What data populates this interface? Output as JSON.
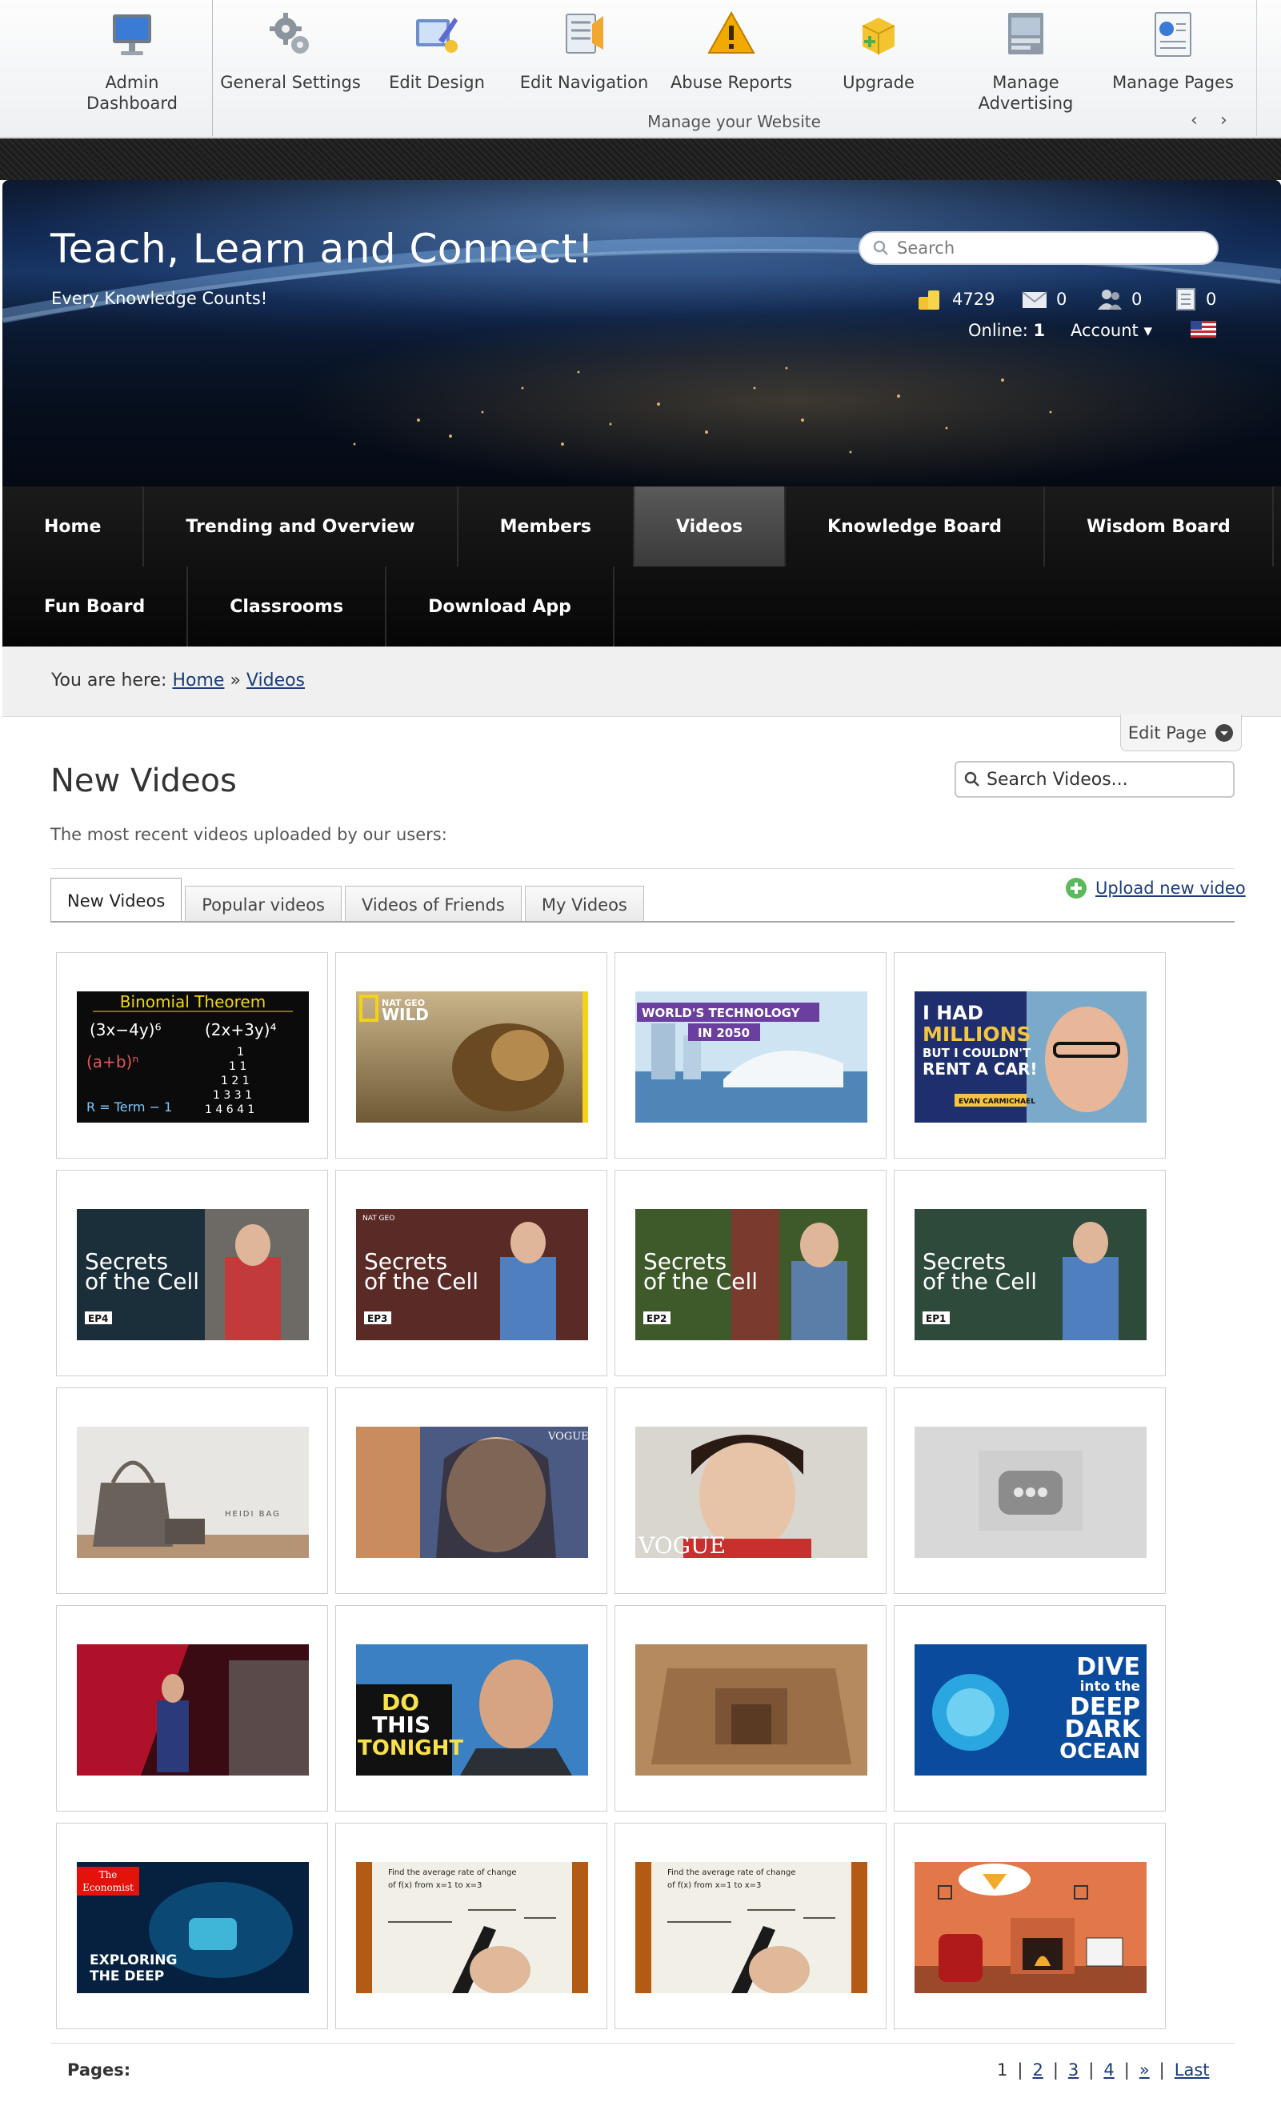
{
  "admin_toolbar": {
    "items": [
      {
        "label": "Admin Dashboard",
        "icon": "monitor-icon"
      },
      {
        "label": "General Settings",
        "icon": "gears-icon"
      },
      {
        "label": "Edit Design",
        "icon": "paint-icon"
      },
      {
        "label": "Edit Navigation",
        "icon": "navigation-icon"
      },
      {
        "label": "Abuse Reports",
        "icon": "warning-icon"
      },
      {
        "label": "Upgrade",
        "icon": "upgrade-box-icon"
      },
      {
        "label": "Manage Advertising",
        "icon": "advertising-icon"
      },
      {
        "label": "Manage Pages",
        "icon": "pages-icon"
      }
    ],
    "caption": "Manage your Website"
  },
  "header": {
    "title": "Teach, Learn and Connect!",
    "tagline": "Every Knowledge Counts!",
    "search_placeholder": "Search",
    "stats": {
      "points": "4729",
      "messages": "0",
      "friend_requests": "0",
      "notifications": "0"
    },
    "online_label": "Online:",
    "online_count": "1",
    "account_label": "Account ▾"
  },
  "nav": {
    "row1": [
      "Home",
      "Trending and Overview",
      "Members",
      "Videos",
      "Knowledge Board",
      "Wisdom Board"
    ],
    "row2": [
      "Fun Board",
      "Classrooms",
      "Download App"
    ],
    "active": "Videos"
  },
  "breadcrumb": {
    "prefix": "You are here:",
    "home": "Home",
    "sep": "»",
    "current": "Videos"
  },
  "edit_page_label": "Edit Page",
  "content": {
    "title": "New Videos",
    "search_placeholder": "Search Videos...",
    "description": "The most recent videos uploaded by our users:",
    "tabs": [
      "New Videos",
      "Popular videos",
      "Videos of Friends",
      "My Videos"
    ],
    "active_tab": "New Videos",
    "upload_label": "Upload new video"
  },
  "videos": [
    {
      "thumb_text": [
        "Binomial Theorem",
        "(3x−4y)⁶",
        "(2x+3y)⁴",
        "(a+b)ⁿ",
        "R = Term − 1"
      ]
    },
    {
      "thumb_text": [
        "NAT GEO",
        "WILD"
      ]
    },
    {
      "thumb_text": [
        "WORLD'S TECHNOLOGY",
        "IN 2050"
      ]
    },
    {
      "thumb_text": [
        "I HAD",
        "MILLIONS",
        "BUT I COULDN'T",
        "RENT A CAR!",
        "EVAN CARMICHAEL"
      ]
    },
    {
      "thumb_text": [
        "Secrets",
        "of the Cell",
        "EP4"
      ]
    },
    {
      "thumb_text": [
        "NAT GEO",
        "Secrets",
        "of the Cell",
        "EP3"
      ]
    },
    {
      "thumb_text": [
        "Secrets",
        "of the Cell",
        "EP2"
      ]
    },
    {
      "thumb_text": [
        "Secrets",
        "of the Cell",
        "EP1"
      ]
    },
    {
      "thumb_text": [
        "HEIDI BAG"
      ]
    },
    {
      "thumb_text": [
        "VOGUE"
      ]
    },
    {
      "thumb_text": [
        "VOGUE"
      ]
    },
    {
      "thumb_text": []
    },
    {
      "thumb_text": []
    },
    {
      "thumb_text": [
        "DO",
        "THIS",
        "TONIGHT"
      ]
    },
    {
      "thumb_text": []
    },
    {
      "thumb_text": [
        "DIVE",
        "into the",
        "DEEP",
        "DARK",
        "OCEAN"
      ]
    },
    {
      "thumb_text": [
        "The",
        "Economist",
        "EXPLORING",
        "THE DEEP"
      ]
    },
    {
      "thumb_text": [
        "Find the average rate of change",
        "of f(x) from x=1 to x=3"
      ]
    },
    {
      "thumb_text": [
        "Find the average rate of change",
        "of f(x) from x=1 to x=3"
      ]
    },
    {
      "thumb_text": []
    }
  ],
  "pagination": {
    "label": "Pages:",
    "current": "1",
    "pages": [
      "2",
      "3",
      "4"
    ],
    "next": "»",
    "last": "Last"
  },
  "colors": {
    "link": "#1b3d7a",
    "nav_bg": "#0b0b0b",
    "banner_top": "#0d2247"
  }
}
